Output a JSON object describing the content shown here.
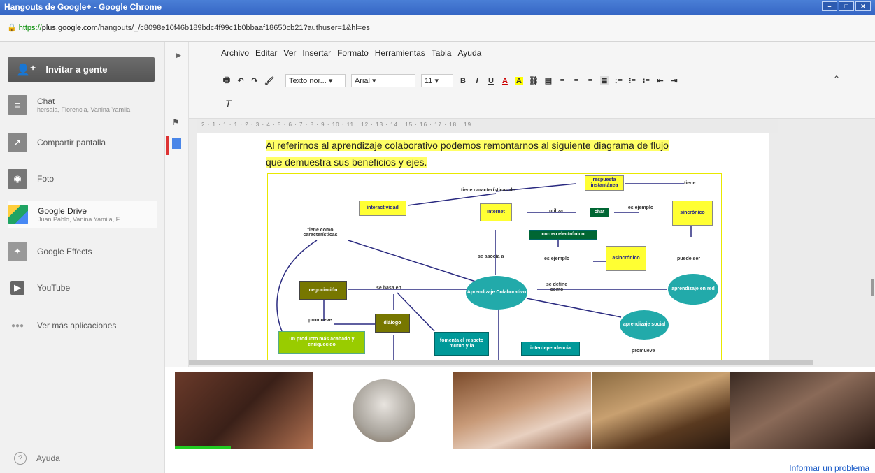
{
  "window": {
    "title": "Hangouts de Google+ - Google Chrome",
    "buttons": [
      "–",
      "□",
      "✕"
    ]
  },
  "address": {
    "scheme": "https://",
    "domain": "plus.google.com",
    "path": "/hangouts/_/c8098e10f46b189bdc4f99c1b0bbaaf18650cb21?authuser=1&hl=es"
  },
  "sidebar": {
    "invite": "Invitar a gente",
    "items": [
      {
        "label": "Chat",
        "sub": "hersala, Florencia, Vanina Yamila",
        "icon": "chat-icon"
      },
      {
        "label": "Compartir pantalla",
        "sub": "",
        "icon": "share-screen-icon"
      },
      {
        "label": "Foto",
        "sub": "",
        "icon": "camera-icon"
      },
      {
        "label": "Google Drive",
        "sub": "Juan Pablo, Vanina Yamila, F...",
        "icon": "drive-icon"
      },
      {
        "label": "Google Effects",
        "sub": "",
        "icon": "effects-icon"
      },
      {
        "label": "YouTube",
        "sub": "",
        "icon": "youtube-icon"
      },
      {
        "label": "Ver más aplicaciones",
        "sub": "",
        "icon": "more-icon"
      }
    ],
    "help": "Ayuda"
  },
  "menu": [
    "Archivo",
    "Editar",
    "Ver",
    "Insertar",
    "Formato",
    "Herramientas",
    "Tabla",
    "Ayuda"
  ],
  "toolbar": {
    "style": "Texto nor...",
    "font": "Arial",
    "size": "11"
  },
  "ruler": "2 · 1 · 1 · 1 · 2 · 3 · 4 · 5 · 6 · 7 · 8 · 9 · 10 · 11 · 12 · 13 · 14 · 15 · 16 · 17 · 18 · 19",
  "doc": {
    "line1": "Al referirnos al aprendizaje colaborativo podemos remontarnos al siguiente diagrama de flujo",
    "line2": "que demuestra sus beneficios y ejes."
  },
  "diagram": {
    "nodes": {
      "respuesta": "respuesta instantánea",
      "interactividad": "interactividad",
      "internet": "Internet",
      "chat": "chat",
      "sincronico": "sincrónico",
      "correo": "correo electrónico",
      "asincronico": "asincrónico",
      "negociacion": "negociación",
      "aprendizaje": "Aprendizaje Colaborativo",
      "enred": "aprendizaje en red",
      "dialogo": "diálogo",
      "social": "aprendizaje social",
      "producto": "un producto más acabado y enriquecido",
      "fomenta": "fomenta el respeto mutuo y la",
      "interdependencia": "interdependencia"
    },
    "labels": {
      "tienecar": "tiene características de",
      "tiene": "tiene",
      "utiliza": "utiliza",
      "esej": "es ejemplo",
      "tienecomo": "tiene como características",
      "seasocia": "se asocia a",
      "esejemplo": "es ejemplo",
      "puedeser": "puede ser",
      "sebasa": "se basa en",
      "sedefine": "se define como",
      "promueve": "promueve",
      "promueve2": "promueve"
    }
  },
  "footer": {
    "report": "Informar un problema"
  }
}
